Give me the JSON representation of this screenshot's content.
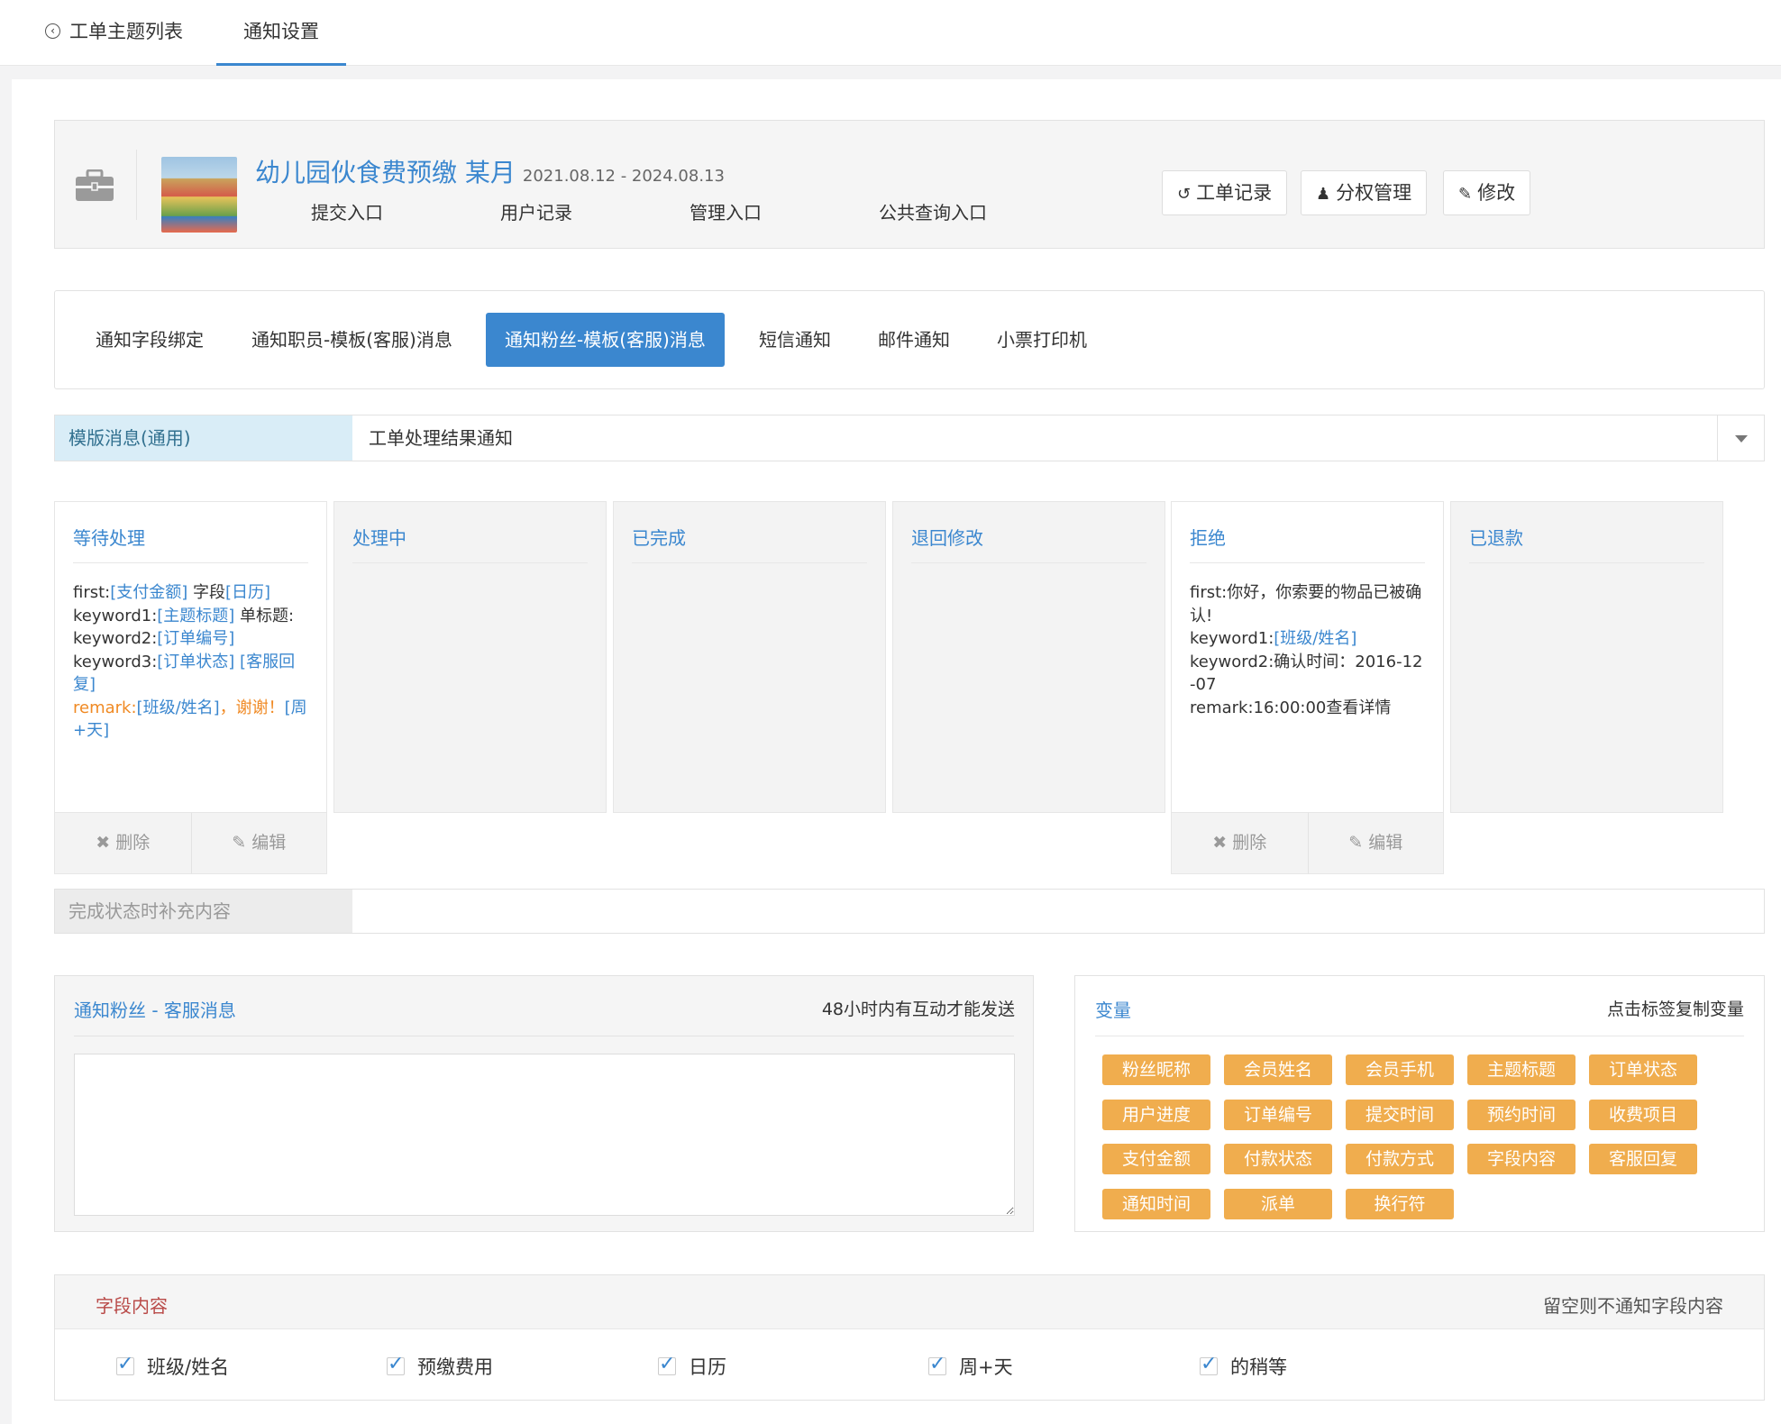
{
  "topnav": {
    "back_label": "工单主题列表",
    "active_label": "通知设置"
  },
  "header": {
    "title": "幼儿园伙食费预缴 某月",
    "date_range": "2021.08.12 - 2024.08.13",
    "links": [
      "提交入口",
      "用户记录",
      "管理入口",
      "公共查询入口"
    ],
    "buttons": {
      "records": "工单记录",
      "perm": "分权管理",
      "edit": "修改"
    }
  },
  "tabs": [
    "通知字段绑定",
    "通知职员-模板(客服)消息",
    "通知粉丝-模板(客服)消息",
    "短信通知",
    "邮件通知",
    "小票打印机"
  ],
  "active_tab": "通知粉丝-模板(客服)消息",
  "template": {
    "label": "模版消息(通用)",
    "value": "工单处理结果通知"
  },
  "status_columns": [
    {
      "title": "等待处理"
    },
    {
      "title": "处理中"
    },
    {
      "title": "已完成"
    },
    {
      "title": "退回修改"
    },
    {
      "title": "拒绝"
    },
    {
      "title": "已退款"
    }
  ],
  "col_pending": {
    "l1a": "first:",
    "l1b": "[支付金额]",
    "l1c": " 字段",
    "l1d": "[日历]",
    "l2a": "keyword1:",
    "l2b": "[主题标题]",
    "l2c": " 单标题:",
    "l3a": "keyword2:",
    "l3b": "[订单编号]",
    "l4a": "keyword3:",
    "l4b": "[订单状态]",
    "l4c": " [客服回复]",
    "l5a": "remark:",
    "l5b": "[班级/姓名]",
    "l5c": "，谢谢！",
    "l5d": "[周+天]"
  },
  "col_reject": {
    "l1": "first:你好，你索要的物品已被确认!",
    "l2a": "keyword1:",
    "l2b": "[班级/姓名]",
    "l3": "keyword2:确认时间：2016-12-07",
    "l4": "remark:16:00:00查看详情"
  },
  "card_actions": {
    "delete": "删除",
    "edit": "编辑"
  },
  "supplement": {
    "label": "完成状态时补充内容",
    "value": ""
  },
  "message": {
    "title": "通知粉丝 - 客服消息",
    "note": "48小时内有互动才能发送",
    "content": ""
  },
  "variables": {
    "title": "变量",
    "note": "点击标签复制变量",
    "tags": [
      "粉丝昵称",
      "会员姓名",
      "会员手机",
      "主题标题",
      "订单状态",
      "用户进度",
      "订单编号",
      "提交时间",
      "预约时间",
      "收费项目",
      "支付金额",
      "付款状态",
      "付款方式",
      "字段内容",
      "客服回复",
      "通知时间",
      "派单",
      "换行符"
    ]
  },
  "fields": {
    "title": "字段内容",
    "note": "留空则不通知字段内容",
    "items": [
      {
        "label": "班级/姓名",
        "checked": true
      },
      {
        "label": "预缴费用",
        "checked": true
      },
      {
        "label": "日历",
        "checked": true
      },
      {
        "label": "周+天",
        "checked": true
      },
      {
        "label": "的稍等",
        "checked": true
      }
    ]
  },
  "colors": {
    "primary": "#3b87cf",
    "tag": "#f0ad4e",
    "label_bg": "#d9edf7",
    "field_title": "#b94a48"
  }
}
